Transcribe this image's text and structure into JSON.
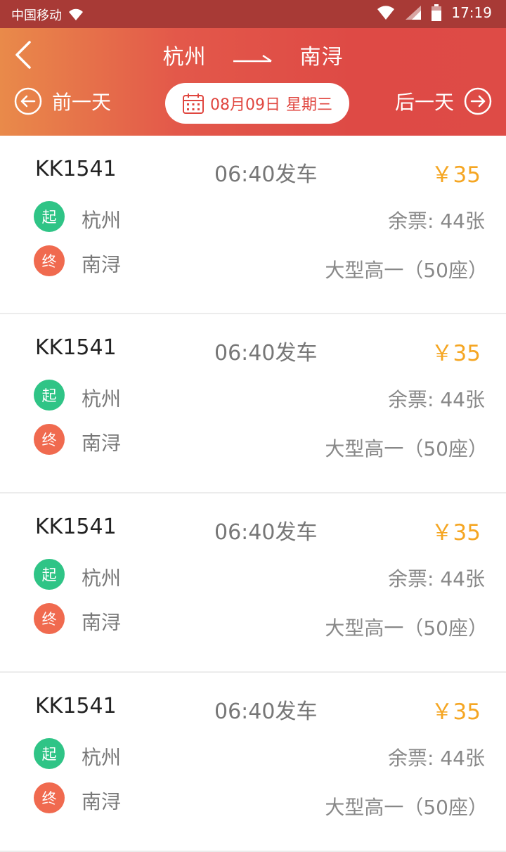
{
  "status_bar": {
    "carrier": "中国移动",
    "time": "17:19"
  },
  "header": {
    "from_city": "杭州",
    "to_city": "南浔",
    "prev_day_label": "前一天",
    "next_day_label": "后一天",
    "date_text": "08月09日",
    "weekday_text": "星期三"
  },
  "trips": [
    {
      "train_no": "KK1541",
      "depart": "06:40发车",
      "price": "￥35",
      "start_badge": "起",
      "end_badge": "终",
      "from": "杭州",
      "to": "南浔",
      "tickets": "余票: 44张",
      "bus_type": "大型高一（50座）"
    },
    {
      "train_no": "KK1541",
      "depart": "06:40发车",
      "price": "￥35",
      "start_badge": "起",
      "end_badge": "终",
      "from": "杭州",
      "to": "南浔",
      "tickets": "余票: 44张",
      "bus_type": "大型高一（50座）"
    },
    {
      "train_no": "KK1541",
      "depart": "06:40发车",
      "price": "￥35",
      "start_badge": "起",
      "end_badge": "终",
      "from": "杭州",
      "to": "南浔",
      "tickets": "余票: 44张",
      "bus_type": "大型高一（50座）"
    },
    {
      "train_no": "KK1541",
      "depart": "06:40发车",
      "price": "￥35",
      "start_badge": "起",
      "end_badge": "终",
      "from": "杭州",
      "to": "南浔",
      "tickets": "余票: 44张",
      "bus_type": "大型高一（50座）"
    }
  ],
  "colors": {
    "header_start": "#e98a4a",
    "header_end": "#de4b46",
    "price": "#f5a623",
    "start_badge": "#2fc486",
    "end_badge": "#f06a4f"
  }
}
